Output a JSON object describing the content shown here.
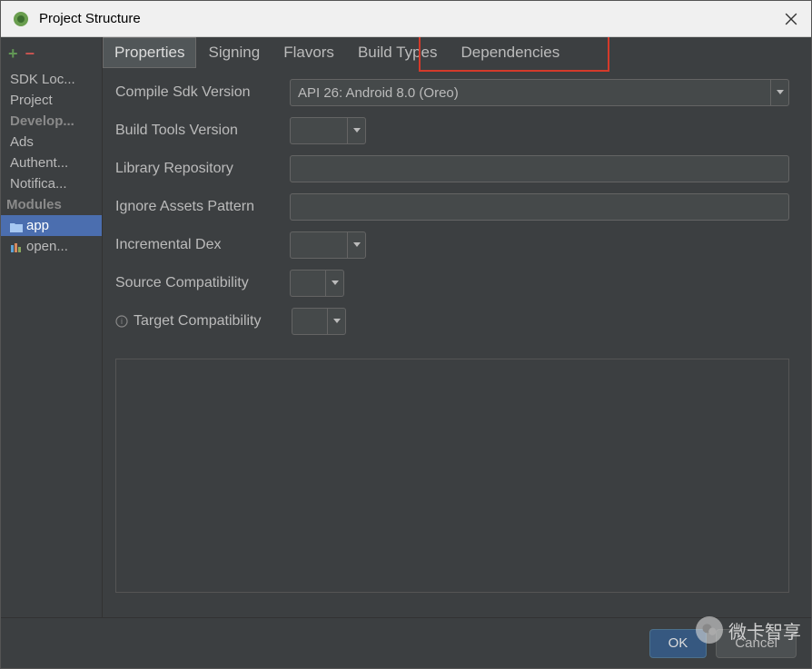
{
  "window": {
    "title": "Project Structure"
  },
  "sidebar": {
    "items": [
      {
        "label": "SDK Loc..."
      },
      {
        "label": "Project"
      },
      {
        "label": "Develop..."
      },
      {
        "label": "Ads"
      },
      {
        "label": "Authent..."
      },
      {
        "label": "Notifica..."
      }
    ],
    "modules_header": "Modules",
    "modules": [
      {
        "label": "app",
        "selected": true,
        "icon": "folder"
      },
      {
        "label": "open...",
        "selected": false,
        "icon": "bars"
      }
    ]
  },
  "tabs": [
    {
      "label": "Properties",
      "active": true
    },
    {
      "label": "Signing",
      "active": false
    },
    {
      "label": "Flavors",
      "active": false
    },
    {
      "label": "Build Types",
      "active": false
    },
    {
      "label": "Dependencies",
      "active": false,
      "highlighted": true
    }
  ],
  "form": {
    "compile_sdk": {
      "label": "Compile Sdk Version",
      "value": "API 26: Android 8.0 (Oreo)"
    },
    "build_tools": {
      "label": "Build Tools Version",
      "value": ""
    },
    "library_repo": {
      "label": "Library Repository",
      "value": ""
    },
    "ignore_assets": {
      "label": "Ignore Assets Pattern",
      "value": ""
    },
    "incremental_dex": {
      "label": "Incremental Dex",
      "value": ""
    },
    "source_compat": {
      "label": "Source Compatibility",
      "value": ""
    },
    "target_compat": {
      "label": "Target Compatibility",
      "value": ""
    }
  },
  "footer": {
    "ok": "OK",
    "cancel": "Cancel"
  },
  "watermark": "微卡智享"
}
